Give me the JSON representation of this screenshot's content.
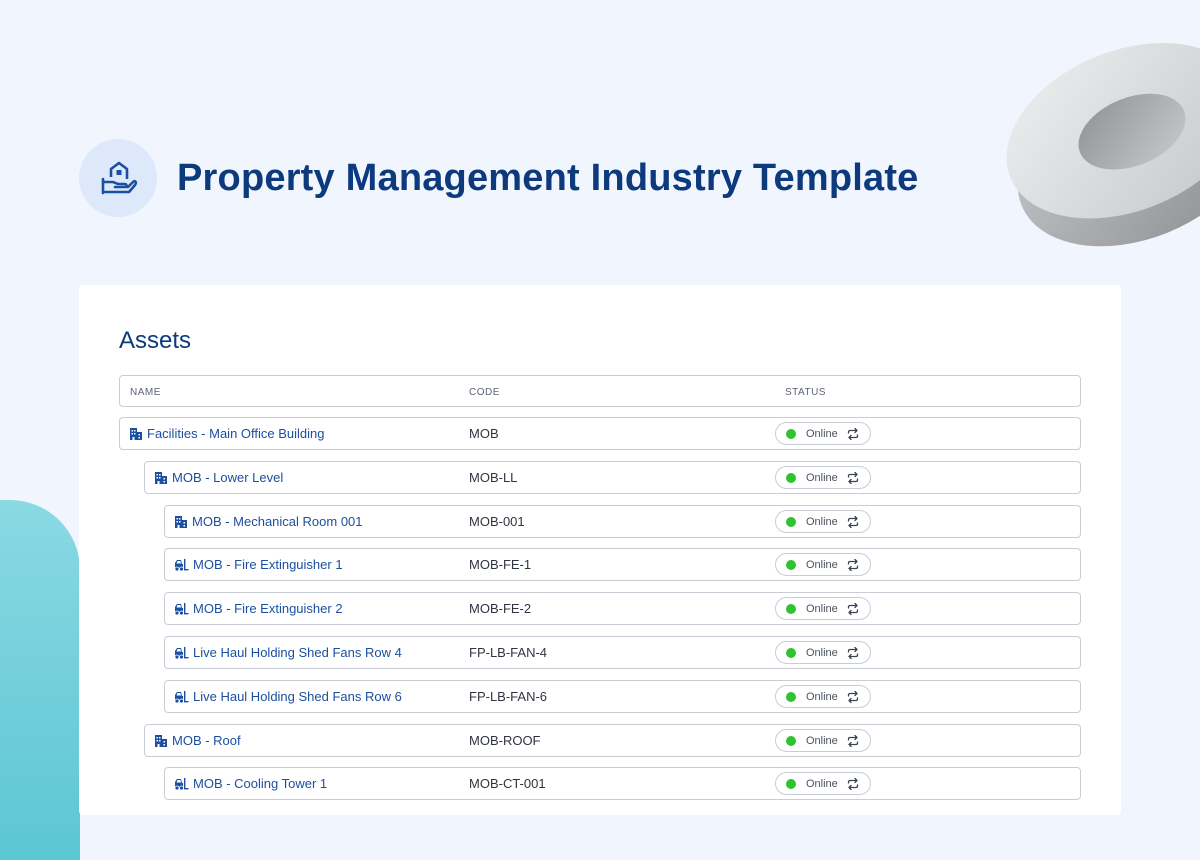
{
  "header": {
    "title": "Property Management Industry Template",
    "logo_icon": "building-in-hand-icon"
  },
  "assets": {
    "title": "Assets",
    "columns": {
      "name": "NAME",
      "code": "CODE",
      "status": "STATUS"
    },
    "rows": [
      {
        "name": "Facilities - Main Office Building",
        "code": "MOB",
        "status": "Online",
        "icon": "building-icon",
        "level": 0
      },
      {
        "name": "MOB - Lower Level",
        "code": "MOB-LL",
        "status": "Online",
        "icon": "building-icon",
        "level": 1
      },
      {
        "name": "MOB - Mechanical Room 001",
        "code": "MOB-001",
        "status": "Online",
        "icon": "building-icon",
        "level": 2
      },
      {
        "name": "MOB - Fire Extinguisher 1",
        "code": "MOB-FE-1",
        "status": "Online",
        "icon": "forklift-icon",
        "level": 2
      },
      {
        "name": "MOB - Fire Extinguisher 2",
        "code": "MOB-FE-2",
        "status": "Online",
        "icon": "forklift-icon",
        "level": 2
      },
      {
        "name": "Live Haul Holding Shed Fans Row 4",
        "code": "FP-LB-FAN-4",
        "status": "Online",
        "icon": "forklift-icon",
        "level": 2
      },
      {
        "name": "Live Haul Holding Shed Fans Row 6",
        "code": "FP-LB-FAN-6",
        "status": "Online",
        "icon": "forklift-icon",
        "level": 2
      },
      {
        "name": "MOB - Roof",
        "code": "MOB-ROOF",
        "status": "Online",
        "icon": "building-icon",
        "level": 1
      },
      {
        "name": "MOB - Cooling Tower 1",
        "code": "MOB-CT-001",
        "status": "Online",
        "icon": "forklift-icon",
        "level": 2
      }
    ]
  },
  "colors": {
    "brand": "#0c3a7d",
    "link": "#1c4fa0",
    "online": "#2fc32f",
    "background": "#f1f6fe"
  }
}
